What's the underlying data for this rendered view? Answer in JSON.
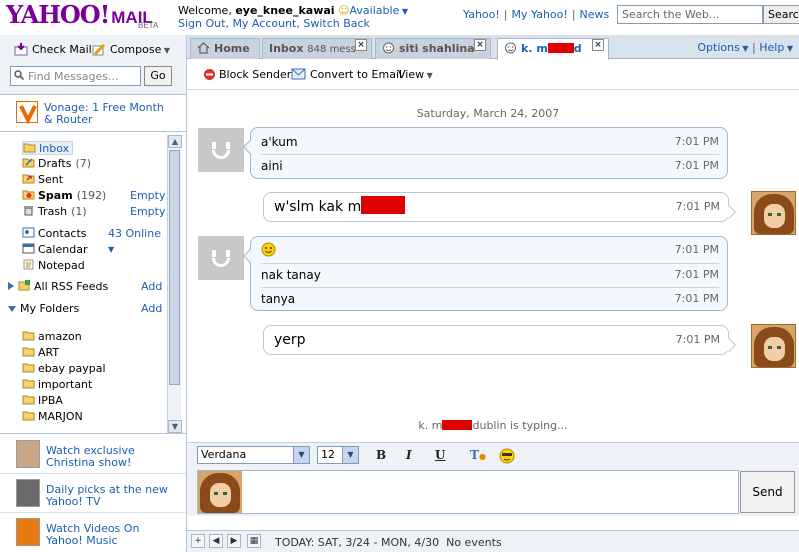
{
  "header": {
    "logo": "YAHOO!",
    "logo_mail": "MAIL",
    "beta": "BETA",
    "welcome_prefix": "Welcome, ",
    "username": "eye_knee_kawai",
    "status": "Available",
    "links": [
      "Sign Out",
      "My Account",
      "Switch Back"
    ],
    "top_links": [
      "Yahoo!",
      "My Yahoo!",
      "News"
    ],
    "search_placeholder": "Search the Web...",
    "search_button": "Search"
  },
  "toolbar": {
    "check_mail": "Check Mail",
    "compose": "Compose",
    "find_placeholder": "Find Messages...",
    "go": "Go"
  },
  "promo_top": "Vonage: 1 Free Month & Router",
  "folders": [
    {
      "label": "Inbox",
      "count": "",
      "action": ""
    },
    {
      "label": "Drafts",
      "count": "(7)",
      "action": ""
    },
    {
      "label": "Sent",
      "count": "",
      "action": ""
    },
    {
      "label": "Spam",
      "count": "(192)",
      "action": "Empty"
    },
    {
      "label": "Trash",
      "count": "(1)",
      "action": "Empty"
    }
  ],
  "apps": {
    "contacts": "Contacts",
    "online": "43 Online",
    "calendar": "Calendar",
    "notepad": "Notepad",
    "rss": "All RSS Feeds",
    "rss_add": "Add",
    "my_folders": "My Folders",
    "my_folders_add": "Add"
  },
  "my_folders": [
    "amazon",
    "ART",
    "ebay paypal",
    "important",
    "IPBA",
    "MARJON"
  ],
  "promos": [
    "Watch exclusive Christina show!",
    "Daily picks at the new Yahoo! TV",
    "Watch Videos On Yahoo! Music"
  ],
  "tabs": {
    "home": "Home",
    "inbox": "Inbox",
    "inbox_count": "848 mess",
    "siti": "siti shahlina",
    "active_prefix": "k. m",
    "active_suffix": "d",
    "options": "Options",
    "help": "Help"
  },
  "im_toolbar": {
    "block": "Block Sender",
    "convert": "Convert to Email",
    "view": "View"
  },
  "chat": {
    "date": "Saturday, March 24, 2007",
    "blocks": [
      {
        "side": "in",
        "lines": [
          {
            "text": "a'kum",
            "time": "7:01 PM"
          },
          {
            "text": "aini",
            "time": "7:01 PM"
          }
        ]
      },
      {
        "side": "out",
        "lines": [
          {
            "text": "w'slm kak m",
            "time": "7:01 PM"
          }
        ]
      },
      {
        "side": "in",
        "lines": [
          {
            "text": ":)",
            "time": "7:01 PM"
          },
          {
            "text": "nak tanay",
            "time": "7:01 PM"
          },
          {
            "text": "tanya",
            "time": "7:01 PM"
          }
        ]
      },
      {
        "side": "out",
        "lines": [
          {
            "text": "yerp",
            "time": "7:01 PM"
          }
        ]
      }
    ],
    "typing_prefix": "k. m",
    "typing_suffix": "dublin is typing..."
  },
  "format": {
    "font": "Verdana",
    "size": "12",
    "bold": "B",
    "italic": "I",
    "underline": "U"
  },
  "send": "Send",
  "statusbar": {
    "today": "TODAY: SAT, 3/24 - MON, 4/30",
    "events": "No events"
  },
  "colors": {
    "accent": "#7b0099",
    "link": "#1a5fb4",
    "redaction": "#e00000"
  }
}
